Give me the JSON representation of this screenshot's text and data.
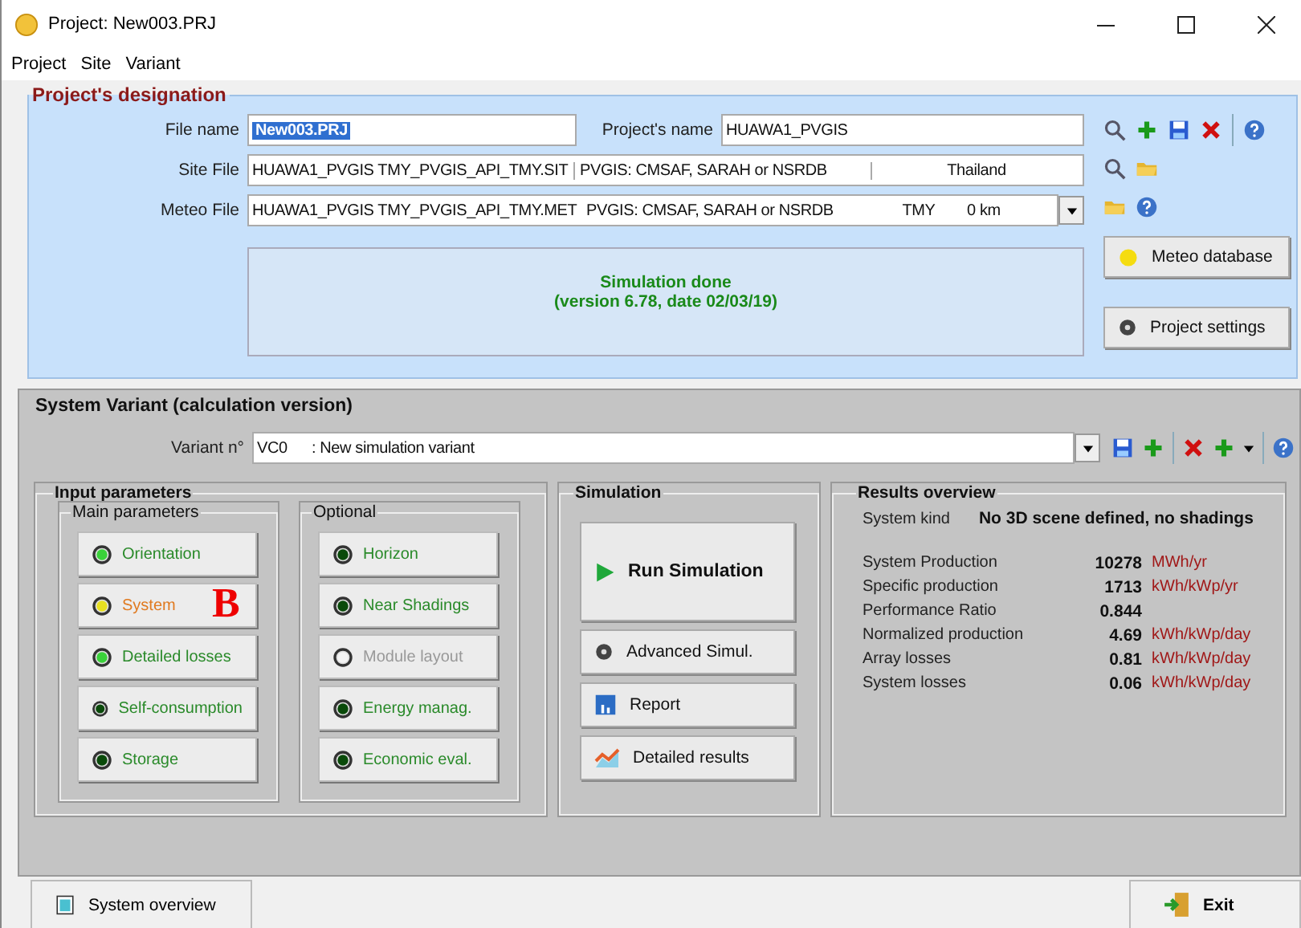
{
  "window": {
    "title": "Project: New003.PRJ"
  },
  "menu": [
    {
      "label": "Project"
    },
    {
      "label": "Site"
    },
    {
      "label": "Variant"
    }
  ],
  "project": {
    "title": "Project's designation",
    "file_name": {
      "label": "File name",
      "value": "New003.PRJ",
      "text_selected": true
    },
    "project_name": {
      "label": "Project's name",
      "value": "HUAWA1_PVGIS"
    },
    "site_file": {
      "label": "Site File",
      "value": "HUAWA1_PVGIS TMY_PVGIS_API_TMY.SIT",
      "source": "PVGIS: CMSAF, SARAH or NSRDB",
      "country": "Thailand"
    },
    "meteo_file": {
      "label": "Meteo File",
      "value": "HUAWA1_PVGIS TMY_PVGIS_API_TMY.MET",
      "source": "PVGIS: CMSAF, SARAH or NSRDB",
      "type": "TMY",
      "distance": "0 km"
    },
    "status": [
      "Simulation done",
      "(version 6.78, date 02/03/19)"
    ],
    "buttons": [
      {
        "label": "Meteo database",
        "kind": "sun"
      },
      {
        "label": "Project settings",
        "kind": "gear"
      }
    ]
  },
  "variant": {
    "title": "System Variant (calculation version)",
    "label": "Variant n°",
    "code": "VC0",
    "name": ": New simulation variant"
  },
  "input_parameters": {
    "title": "Input parameters",
    "main": {
      "title": "Main parameters",
      "items": [
        {
          "label": "Orientation",
          "color": "#3ad13a",
          "warning": false,
          "disabled": false
        },
        {
          "label": "System",
          "color": "#e8e020",
          "warning": true,
          "disabled": false,
          "annotation": "B"
        },
        {
          "label": "Detailed losses",
          "color": "#3ad13a",
          "warning": false,
          "disabled": false
        },
        {
          "label": "Self-consumption",
          "color": "#0a4a0a",
          "warning": false,
          "disabled": false
        },
        {
          "label": "Storage",
          "color": "#0a4a0a",
          "warning": false,
          "disabled": false
        }
      ]
    },
    "optional": {
      "title": "Optional",
      "items": [
        {
          "label": "Horizon",
          "color": "#0a4a0a",
          "warning": false,
          "disabled": false
        },
        {
          "label": "Near Shadings",
          "color": "#0a4a0a",
          "warning": false,
          "disabled": false
        },
        {
          "label": "Module layout",
          "color": "#f4f4f4",
          "warning": false,
          "disabled": true
        },
        {
          "label": "Energy manag.",
          "color": "#0a4a0a",
          "warning": false,
          "disabled": false
        },
        {
          "label": "Economic eval.",
          "color": "#0a4a0a",
          "warning": false,
          "disabled": false
        }
      ]
    }
  },
  "simulation": {
    "title": "Simulation",
    "buttons": [
      {
        "label": "Run Simulation",
        "kind": "run"
      },
      {
        "label": "Advanced Simul.",
        "kind": "gear"
      },
      {
        "label": "Report",
        "kind": "report"
      },
      {
        "label": "Detailed results",
        "kind": "chart"
      }
    ]
  },
  "results": {
    "title": "Results overview",
    "system_kind": {
      "label": "System kind",
      "value": "No 3D scene defined, no shadings"
    },
    "rows": [
      {
        "label": "System Production",
        "value": "10278",
        "unit": "MWh/yr"
      },
      {
        "label": "Specific production",
        "value": "1713",
        "unit": "kWh/kWp/yr"
      },
      {
        "label": "Performance Ratio",
        "value": "0.844"
      },
      {
        "label": "Normalized production",
        "value": "4.69",
        "unit": "kWh/kWp/day"
      },
      {
        "label": "Array losses",
        "value": "0.81",
        "unit": "kWh/kWp/day"
      },
      {
        "label": "System losses",
        "value": "0.06",
        "unit": "kWh/kWp/day"
      }
    ]
  },
  "footer": {
    "buttons": [
      {
        "label": "System overview",
        "kind": "overview"
      },
      {
        "label": "Exit",
        "kind": "exit"
      }
    ]
  }
}
